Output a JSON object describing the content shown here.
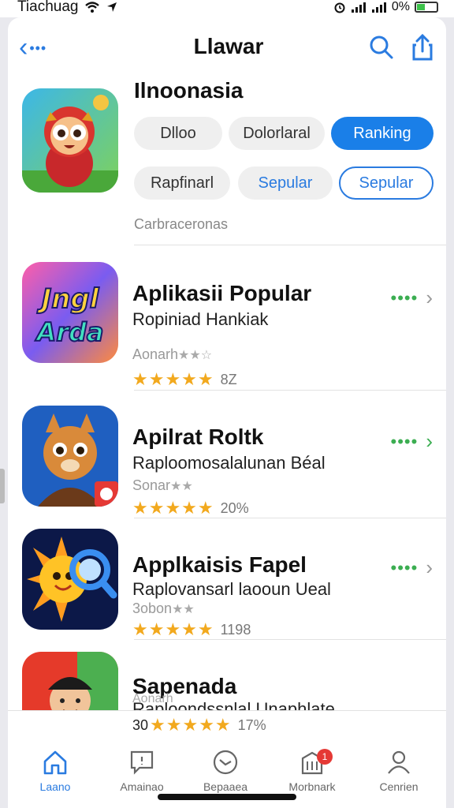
{
  "status_bar": {
    "carrier": "Tiachuag",
    "battery": "0%"
  },
  "nav": {
    "title": "Llawar"
  },
  "header": {
    "title": "Ilnoonasia",
    "category_label": "Carbraceronas"
  },
  "chips": [
    {
      "label": "Dlloo",
      "style": "grey"
    },
    {
      "label": "Dolorlaral",
      "style": "grey"
    },
    {
      "label": "Ranking",
      "style": "active"
    },
    {
      "label": "Rapfinarl",
      "style": "grey"
    },
    {
      "label": "Sepular",
      "style": "grey-blue"
    },
    {
      "label": "Sepular",
      "style": "outline"
    }
  ],
  "apps": [
    {
      "title": "Aplikasii Popular",
      "subtitle": "Ropiniad Hankiak",
      "small": "Aonarh",
      "stars": "★★★★★",
      "count": "8Z",
      "icon": "jingle-art-icon"
    },
    {
      "title": "Apilrat Roltk",
      "subtitle": "Raploomosalalunan Béal",
      "small": "Sonar",
      "stars": "★★★★★",
      "count": "20%",
      "icon": "fox-monk-icon"
    },
    {
      "title": "Applkaisis Fapel",
      "subtitle": "Raplovansarl laooun Ueal",
      "small": "3obon",
      "stars": "★★★★★",
      "count": "1198",
      "icon": "sun-magnifier-icon"
    },
    {
      "title": "Sapenada",
      "subtitle": "Raploondssnlal Unaphlate",
      "small": "Aonarh",
      "stars": "★★★★★",
      "count": "17%",
      "count_prefix": "30",
      "icon": "cap-avatar-icon"
    }
  ],
  "tabs": [
    {
      "label": "Laano",
      "icon": "home-icon",
      "active": true
    },
    {
      "label": "Amainao",
      "icon": "message-icon",
      "active": false
    },
    {
      "label": "Bepaaea",
      "icon": "clock-icon",
      "active": false
    },
    {
      "label": "Morbnark",
      "icon": "building-icon",
      "active": false,
      "badge": "1"
    },
    {
      "label": "Cenrien",
      "icon": "person-icon",
      "active": false
    }
  ],
  "colors": {
    "accent": "#1a7fe8",
    "star": "#f2a91e",
    "more": "#3cae52"
  }
}
